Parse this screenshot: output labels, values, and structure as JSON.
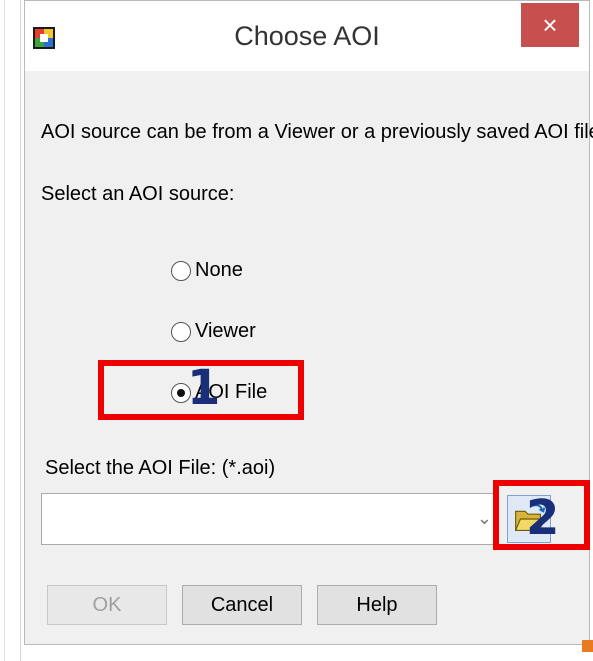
{
  "window": {
    "title": "Choose AOI",
    "close_glyph": "×",
    "app_icon": "aoi-app-icon"
  },
  "content": {
    "description": "AOI source can be from a Viewer or a previously saved AOI file.",
    "select_source_label": "Select an AOI source:",
    "radio_options": [
      {
        "label": "None",
        "selected": false
      },
      {
        "label": "Viewer",
        "selected": false
      },
      {
        "label": "AOI File",
        "selected": true
      }
    ],
    "file_label": "Select the AOI File: (*.aoi)",
    "file_value": "",
    "browse_icon": "open-folder-icon"
  },
  "buttons": {
    "ok": "OK",
    "cancel": "Cancel",
    "help": "Help"
  },
  "annotations": [
    {
      "number": "1",
      "color": "#ee0000"
    },
    {
      "number": "2",
      "color": "#ee0000"
    }
  ]
}
